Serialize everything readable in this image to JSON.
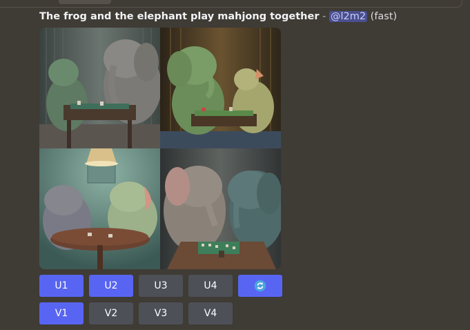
{
  "message": {
    "prompt": "The frog and the elephant play mahjong together",
    "separator": "-",
    "mention": "@l2m2",
    "speed": "(fast)"
  },
  "image_grid": {
    "panels": [
      {
        "position": "top-left",
        "wall_color": "#4b5553"
      },
      {
        "position": "top-right",
        "wall_color": "#3d2f1f"
      },
      {
        "position": "bottom-left",
        "wall_color": "#4b6c67"
      },
      {
        "position": "bottom-right",
        "wall_color": "#393d3e"
      }
    ]
  },
  "buttons": {
    "upscale": [
      {
        "label": "U1",
        "active": true
      },
      {
        "label": "U2",
        "active": true
      },
      {
        "label": "U3",
        "active": false
      },
      {
        "label": "U4",
        "active": false
      }
    ],
    "reroll": {
      "icon": "refresh-icon",
      "active": true
    },
    "variation": [
      {
        "label": "V1",
        "active": true
      },
      {
        "label": "V2",
        "active": false
      },
      {
        "label": "V3",
        "active": false
      },
      {
        "label": "V4",
        "active": false
      }
    ]
  },
  "colors": {
    "background": "#3f3b35",
    "button_active": "#5865f2",
    "button_inactive": "#4e5058",
    "mention_bg": "#4a4f8f"
  }
}
